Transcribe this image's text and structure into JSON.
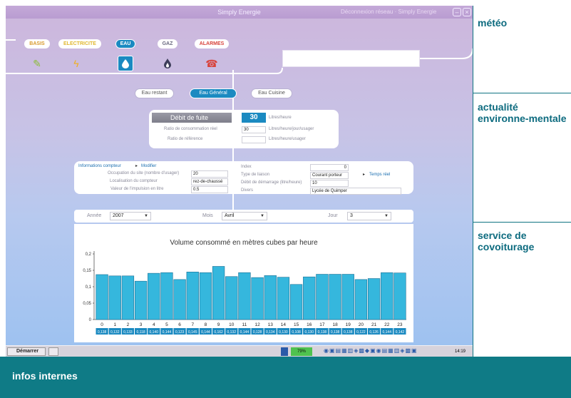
{
  "window": {
    "title": "Simply Energie",
    "subtitle": "Déconnexion réseau · Simply Energie"
  },
  "nav": {
    "items": [
      {
        "label": "BASIS"
      },
      {
        "label": "ELECTRICITE"
      },
      {
        "label": "EAU"
      },
      {
        "label": "GAZ"
      },
      {
        "label": "ALARMES"
      }
    ],
    "active": "EAU"
  },
  "water_tabs": [
    {
      "label": "Eau restant"
    },
    {
      "label": "Eau Général"
    },
    {
      "label": "Eau Cuisine"
    }
  ],
  "leak": {
    "title": "Débit de fuite",
    "value": "30",
    "unit": "Litres/heure",
    "fields": [
      {
        "label": "Ratio de consommation réel",
        "value": "30",
        "unit": "Litres/heure/jour/usager"
      },
      {
        "label": "Ratio de référence",
        "value": "",
        "unit": "Litres/heure/usager"
      }
    ]
  },
  "meter": {
    "header": "Informations compteur",
    "edit_link": "Modifier",
    "left_fields": [
      {
        "label": "Occupation du site (nombre d'usager)",
        "value": "20"
      },
      {
        "label": "Localisation du compteur",
        "value": "rez-de-chaussé"
      },
      {
        "label": "Valeur de l'impulsion en litre",
        "value": "0.5"
      }
    ],
    "right_fields": [
      {
        "label": "Index",
        "value": "0"
      },
      {
        "label": "Type de liaison",
        "value": "Courant porteur"
      },
      {
        "label": "Débit de démarrage (litre/heure)",
        "value": "10"
      },
      {
        "label": "Divers",
        "value": "Lycée de Quimper"
      }
    ],
    "realtime_link": "Temps réel"
  },
  "filters": {
    "year_label": "Année",
    "year_value": "2007",
    "month_label": "Mois",
    "month_value": "Avril",
    "day_label": "Jour",
    "day_value": "3"
  },
  "chart_data": {
    "type": "bar",
    "title": "Volume consommé en mètres cubes par heure",
    "xlabel": "",
    "ylabel": "",
    "categories": [
      "0",
      "1",
      "2",
      "3",
      "4",
      "5",
      "6",
      "7",
      "8",
      "9",
      "10",
      "11",
      "12",
      "13",
      "14",
      "15",
      "16",
      "17",
      "18",
      "19",
      "20",
      "21",
      "22",
      "23"
    ],
    "values": [
      0.137,
      0.133,
      0.133,
      0.117,
      0.141,
      0.143,
      0.122,
      0.145,
      0.143,
      0.162,
      0.131,
      0.143,
      0.128,
      0.134,
      0.129,
      0.107,
      0.13,
      0.138,
      0.138,
      0.138,
      0.122,
      0.125,
      0.143,
      0.142
    ],
    "ylim": [
      0,
      0.2
    ],
    "yticks": [
      "0",
      "0,05",
      "0,1",
      "0,15",
      "0,2"
    ],
    "bar_labels": [
      "0,138",
      "0,132",
      "0,133",
      "0,118",
      "0,140",
      "0,144",
      "0,123",
      "0,145",
      "0,144",
      "0,162",
      "0,132",
      "0,144",
      "0,128",
      "0,134",
      "0,130",
      "0,108",
      "0,130",
      "0,138",
      "0,138",
      "0,138",
      "0,122",
      "0,126",
      "0,144",
      "0,142"
    ],
    "bar_color": "#35b7dd",
    "grid": false
  },
  "taskbar": {
    "start": "Démarrer",
    "battery": "79%",
    "clock": "14:19"
  },
  "right": {
    "s1": "météo",
    "s2": "actualité environne-mentale",
    "s3": "service de covoiturage"
  },
  "bottom": {
    "text": "infos internes"
  },
  "colors": {
    "accent": "#1b8ac1",
    "teal": "#0f7b86",
    "bar": "#35b7dd"
  }
}
